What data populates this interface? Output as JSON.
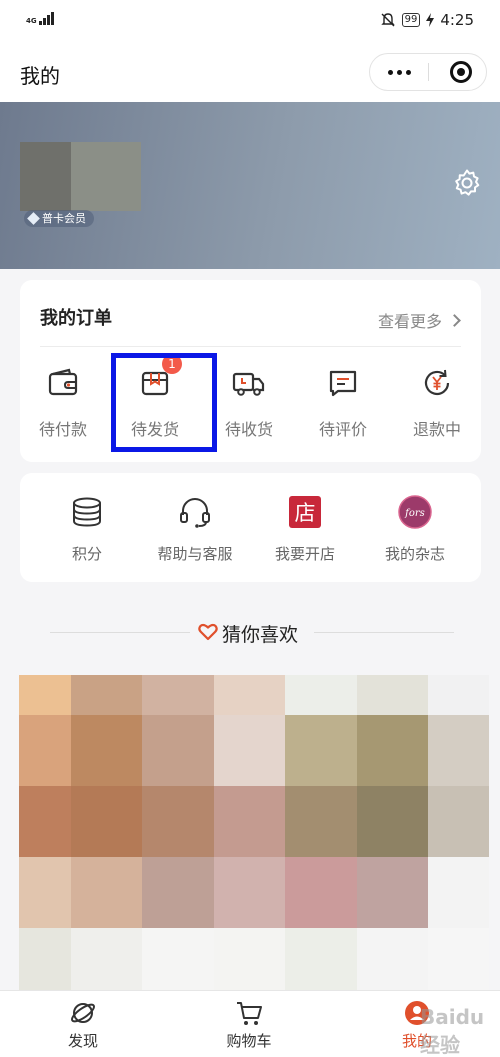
{
  "status_bar": {
    "network": "4G",
    "battery": "99",
    "time": "4:25"
  },
  "nav": {
    "title": "我的"
  },
  "profile": {
    "member_badge": "普卡会员"
  },
  "orders": {
    "title": "我的订单",
    "more": "查看更多",
    "items": [
      {
        "label": "待付款",
        "icon": "wallet-icon"
      },
      {
        "label": "待发货",
        "icon": "package-icon",
        "badge": "1"
      },
      {
        "label": "待收货",
        "icon": "delivery-truck-icon"
      },
      {
        "label": "待评价",
        "icon": "comment-icon"
      },
      {
        "label": "退款中",
        "icon": "refund-icon"
      }
    ]
  },
  "services": {
    "items": [
      {
        "label": "积分",
        "icon": "coins-stack-icon"
      },
      {
        "label": "帮助与客服",
        "icon": "headset-icon"
      },
      {
        "label": "我要开店",
        "icon": "shop-icon",
        "icon_text": "店"
      },
      {
        "label": "我的杂志",
        "icon": "magazine-icon",
        "icon_text": "fors"
      }
    ]
  },
  "recommend": {
    "title": "猜你喜欢"
  },
  "tabbar": {
    "items": [
      {
        "label": "发现",
        "icon": "planet-icon"
      },
      {
        "label": "购物车",
        "icon": "cart-icon"
      },
      {
        "label": "我的",
        "icon": "profile-icon",
        "active": true
      }
    ]
  },
  "watermark": "Baidu 经验",
  "colors": {
    "accent": "#e0502c",
    "badge": "#f35a4a",
    "highlight_box": "#0b18e6",
    "shop_icon_bg": "#c8283a"
  }
}
